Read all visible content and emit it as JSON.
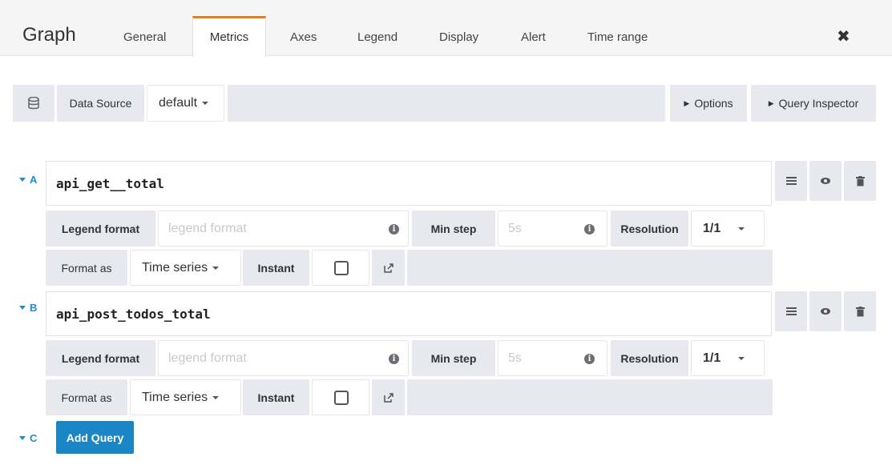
{
  "header": {
    "title": "Graph",
    "tabs": [
      "General",
      "Metrics",
      "Axes",
      "Legend",
      "Display",
      "Alert",
      "Time range"
    ],
    "active_tab": "Metrics"
  },
  "datasource": {
    "label": "Data Source",
    "value": "default",
    "options_label": "Options",
    "inspector_label": "Query Inspector"
  },
  "queries": [
    {
      "letter": "A",
      "expr": "api_get__total",
      "legend_label": "Legend format",
      "legend_placeholder": "legend format",
      "min_step_label": "Min step",
      "min_step_placeholder": "5s",
      "resolution_label": "Resolution",
      "resolution_value": "1/1",
      "format_as_label": "Format as",
      "format_value": "Time series",
      "instant_label": "Instant"
    },
    {
      "letter": "B",
      "expr": "api_post_todos_total",
      "legend_label": "Legend format",
      "legend_placeholder": "legend format",
      "min_step_label": "Min step",
      "min_step_placeholder": "5s",
      "resolution_label": "Resolution",
      "resolution_value": "1/1",
      "format_as_label": "Format as",
      "format_value": "Time series",
      "instant_label": "Instant"
    }
  ],
  "add_query": {
    "letter": "C",
    "label": "Add Query"
  },
  "colors": {
    "accent_tab": "#eb7b18",
    "query_letter": "#1f8bd6",
    "add_button": "#1a86c6",
    "panel_gray": "#e7e9ee"
  }
}
